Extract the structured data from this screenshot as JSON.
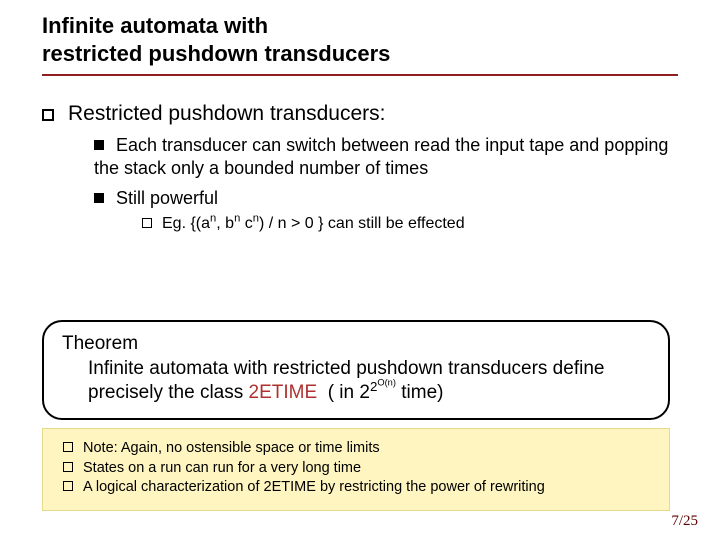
{
  "title_line1": "Infinite automata with",
  "title_line2": "restricted pushdown transducers",
  "section_heading": "Restricted pushdown transducers:",
  "bullet1": "Each transducer can switch between read the input tape and popping the stack only a bounded number of times",
  "bullet2": "Still powerful",
  "eg_prefix": "Eg. {(a",
  "eg_mid1": ", b",
  "eg_mid2": " c",
  "eg_suffix": ") / n > 0 } can still be effected",
  "sup_n": "n",
  "theorem_label": "Theorem",
  "theorem_body1": "Infinite automata with restricted pushdown transducers define precisely the class",
  "etime_label": "2ETIME",
  "theorem_body2": "( in 2",
  "theorem_exp_outer": "2",
  "theorem_exp_inner": "O(n)",
  "theorem_body3": " time)",
  "note1": "Note: Again, no ostensible space or time limits",
  "note2": "States on a run can run for a very long time",
  "note3": "A logical characterization of 2ETIME by restricting the power of rewriting",
  "page_num": "7/25"
}
